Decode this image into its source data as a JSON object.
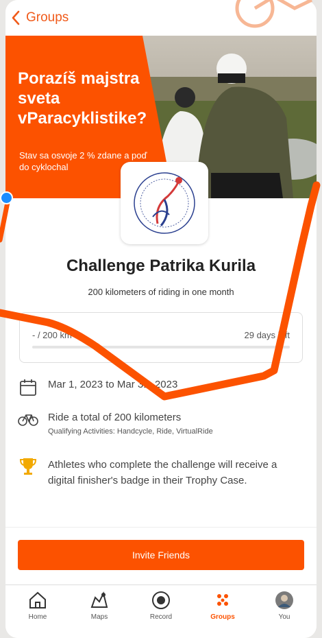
{
  "header": {
    "back_label": "Groups"
  },
  "hero": {
    "title": "Porazíš majstra sveta vParacyklistike?",
    "subtitle": "Stav sa osvoje 2 % zdane a poď do cyklochal"
  },
  "challenge": {
    "title": "Challenge Patrika Kurila",
    "description": "200 kilometers of riding in one month"
  },
  "progress": {
    "current": "- / 200 km",
    "remaining": "29 days left",
    "fraction": 0
  },
  "details": {
    "dates": "Mar 1, 2023 to Mar 31, 2023",
    "goal": "Ride a total of 200 kilometers",
    "qualifying": "Qualifying Activities: Handcycle, Ride, VirtualRide",
    "reward": "Athletes who complete the challenge will receive a digital finisher's badge in their Trophy Case."
  },
  "actions": {
    "invite_label": "Invite Friends"
  },
  "tabs": [
    {
      "label": "Home",
      "icon": "home-icon"
    },
    {
      "label": "Maps",
      "icon": "maps-icon"
    },
    {
      "label": "Record",
      "icon": "record-icon"
    },
    {
      "label": "Groups",
      "icon": "groups-icon",
      "active": true
    },
    {
      "label": "You",
      "icon": "avatar"
    }
  ],
  "colors": {
    "accent": "#fc5200",
    "back_link": "#f05a1a",
    "progress_dash": "#2fbf5a",
    "trophy": "#f2a900",
    "location_dot": "#1a8cff"
  }
}
